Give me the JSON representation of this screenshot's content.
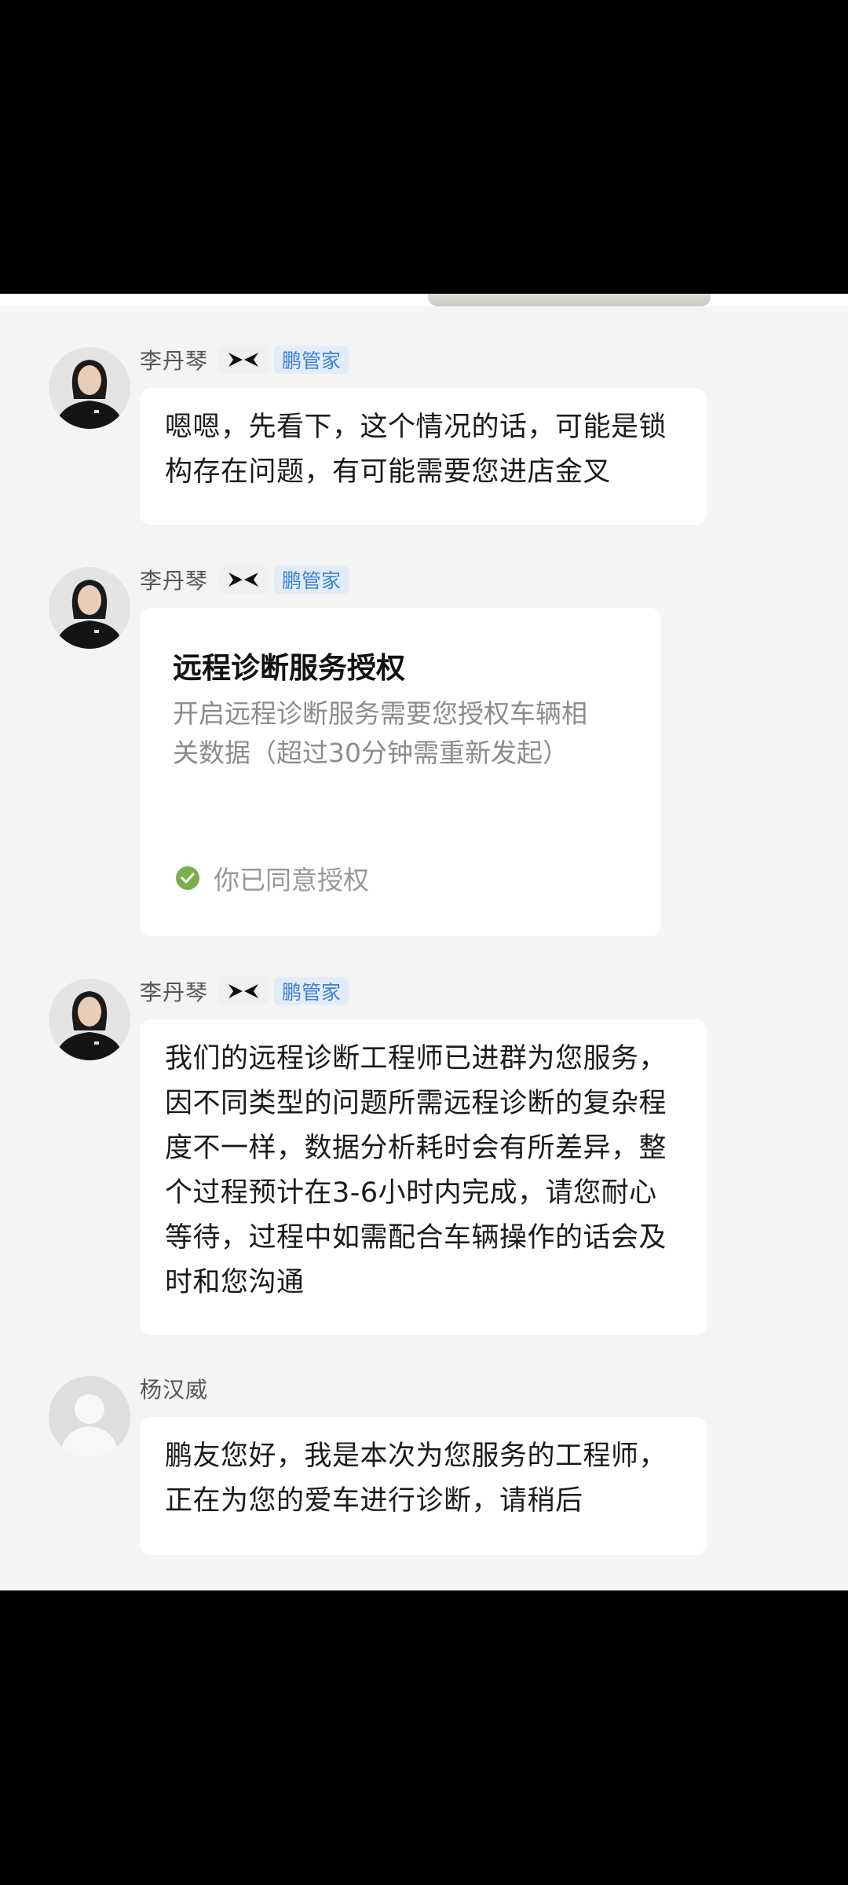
{
  "messages": [
    {
      "sender": "李丹琴",
      "badge": "鹏管家",
      "brand_logo": "xpeng-logo",
      "text": "嗯嗯，先看下，这个情况的话，可能是锁构存在问题，有可能需要您进店金叉"
    },
    {
      "sender": "李丹琴",
      "badge": "鹏管家",
      "brand_logo": "xpeng-logo",
      "card": {
        "title": "远程诊断服务授权",
        "description": "开启远程诊断服务需要您授权车辆相关数据（超过30分钟需重新发起）",
        "status": "你已同意授权"
      }
    },
    {
      "sender": "李丹琴",
      "badge": "鹏管家",
      "brand_logo": "xpeng-logo",
      "text": "我们的远程诊断工程师已进群为您服务，因不同类型的问题所需远程诊断的复杂程度不一样，数据分析耗时会有所差异，整个过程预计在3-6小时内完成，请您耐心等待，过程中如需配合车辆操作的话会及时和您沟通"
    },
    {
      "sender": "杨汉威",
      "text": "鹏友您好，我是本次为您服务的工程师，正在为您的爱车进行诊断，请稍后"
    }
  ],
  "colors": {
    "badge_text": "#3f80d4",
    "badge_bg": "#e2edf9",
    "check": "#7ab04c",
    "chat_bg": "#f4f4f4"
  }
}
